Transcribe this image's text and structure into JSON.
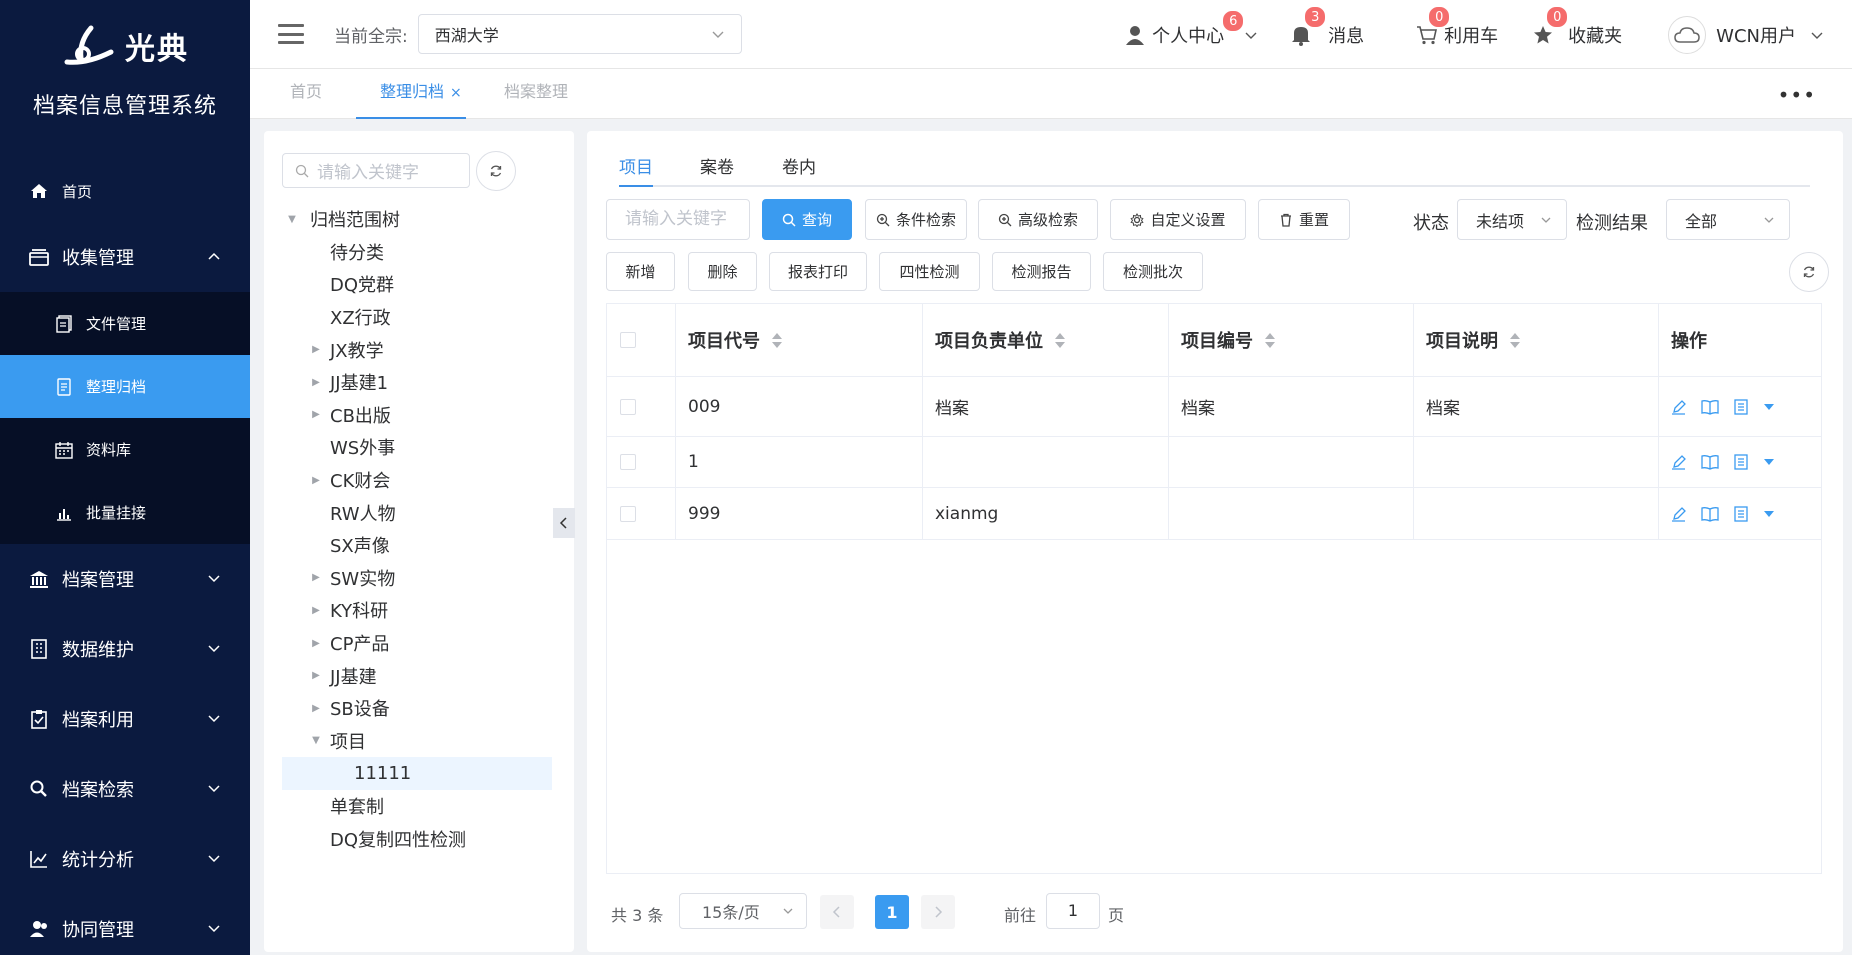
{
  "app": {
    "logo_text": "光典",
    "system_title": "档案信息管理系统"
  },
  "sidebar": {
    "items": [
      {
        "label": "首页"
      },
      {
        "label": "收集管理"
      },
      {
        "label": "档案管理"
      },
      {
        "label": "数据维护"
      },
      {
        "label": "档案利用"
      },
      {
        "label": "档案检索"
      },
      {
        "label": "统计分析"
      },
      {
        "label": "协同管理"
      }
    ],
    "sub_items": [
      {
        "label": "文件管理"
      },
      {
        "label": "整理归档"
      },
      {
        "label": "资料库"
      },
      {
        "label": "批量挂接"
      }
    ]
  },
  "header": {
    "current_label": "当前全宗:",
    "current_value": "西湖大学",
    "profile_label": "个人中心",
    "profile_badge": "6",
    "message_label": "消息",
    "message_badge": "3",
    "cart_label": "利用车",
    "cart_badge": "0",
    "fav_label": "收藏夹",
    "fav_badge": "0",
    "user_label": "WCN用户"
  },
  "tabs": [
    {
      "label": "首页"
    },
    {
      "label": "整理归档",
      "close": "×"
    },
    {
      "label": "档案整理"
    }
  ],
  "tree": {
    "search_placeholder": "请输入关键字",
    "nodes": [
      {
        "label": "归档范围树",
        "arrow": "▼"
      },
      {
        "label": "待分类",
        "arrow": ""
      },
      {
        "label": "DQ党群",
        "arrow": ""
      },
      {
        "label": "XZ行政",
        "arrow": ""
      },
      {
        "label": "JX教学",
        "arrow": "▶"
      },
      {
        "label": "JJ基建1",
        "arrow": "▶"
      },
      {
        "label": "CB出版",
        "arrow": "▶"
      },
      {
        "label": "WS外事",
        "arrow": ""
      },
      {
        "label": "CK财会",
        "arrow": "▶"
      },
      {
        "label": "RW人物",
        "arrow": ""
      },
      {
        "label": "SX声像",
        "arrow": ""
      },
      {
        "label": "SW实物",
        "arrow": "▶"
      },
      {
        "label": "KY科研",
        "arrow": "▶"
      },
      {
        "label": "CP产品",
        "arrow": "▶"
      },
      {
        "label": "JJ基建",
        "arrow": "▶"
      },
      {
        "label": "SB设备",
        "arrow": "▶"
      },
      {
        "label": "项目",
        "arrow": "▼"
      },
      {
        "label": "11111",
        "arrow": ""
      },
      {
        "label": "单套制",
        "arrow": ""
      },
      {
        "label": "DQ复制四性检测",
        "arrow": ""
      }
    ]
  },
  "panel_tabs": [
    {
      "label": "项目"
    },
    {
      "label": "案卷"
    },
    {
      "label": "卷内"
    }
  ],
  "toolbar": {
    "keyword_placeholder": "请输入关键字",
    "query": "查询",
    "condition_search": "条件检索",
    "advanced_search": "高级检索",
    "custom_settings": "自定义设置",
    "reset": "重置",
    "status_label": "状态",
    "status_value": "未结项",
    "check_label": "检测结果",
    "check_value": "全部",
    "add": "新增",
    "delete": "删除",
    "print": "报表打印",
    "four_check": "四性检测",
    "check_report": "检测报告",
    "check_batch": "检测批次"
  },
  "table": {
    "headers": [
      "项目代号",
      "项目负责单位",
      "项目编号",
      "项目说明",
      "操作"
    ],
    "rows": [
      [
        "009",
        "档案",
        "档案",
        "档案"
      ],
      [
        "1",
        "",
        "",
        ""
      ],
      [
        "999",
        "xianmg",
        "",
        ""
      ]
    ]
  },
  "pager": {
    "total": "共 3 条",
    "page_size": "15条/页",
    "current": "1",
    "goto_label": "前往",
    "goto_value": "1",
    "page_unit": "页"
  },
  "colors": {
    "sidebar_bg": "#0b1a3f",
    "accent": "#3a9bf0",
    "badge": "#f56c6c"
  }
}
